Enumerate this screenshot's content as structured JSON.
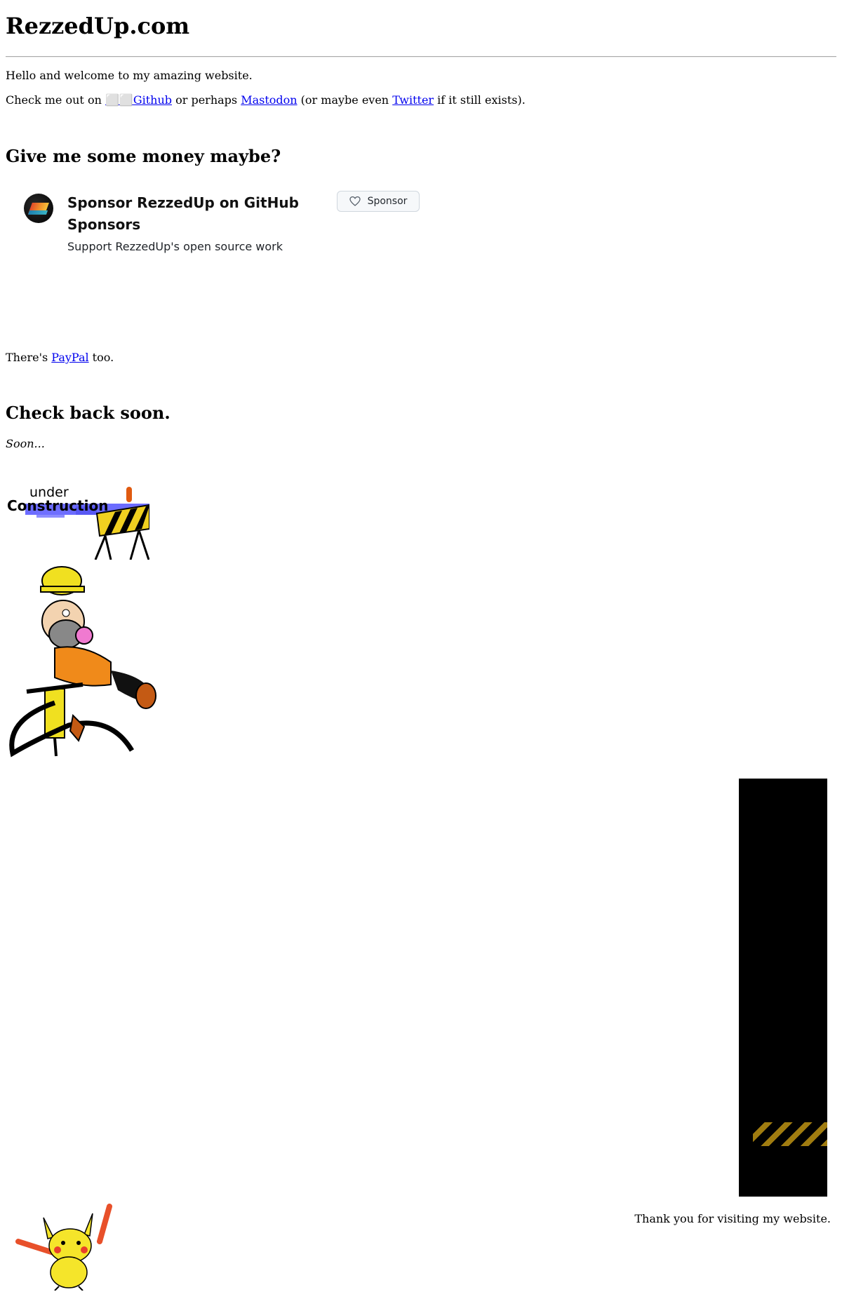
{
  "header": {
    "site_title": "RezzedUp.com"
  },
  "intro": {
    "welcome": "Hello and welcome to my amazing website.",
    "check_prefix": "Check me out on ",
    "github_link": "⬜⬜Github",
    "mid1": " or perhaps ",
    "mastodon_link": "Mastodon",
    "mid2": " (or maybe even ",
    "twitter_link": "Twitter",
    "suffix": " if it still exists)."
  },
  "money": {
    "heading": "Give me some money maybe?",
    "sponsor_title": "Sponsor RezzedUp on GitHub Sponsors",
    "sponsor_subtitle": "Support RezzedUp's open source work",
    "sponsor_button": "Sponsor",
    "paypal_prefix": "There's ",
    "paypal_link": "PayPal",
    "paypal_suffix": " too."
  },
  "soon": {
    "heading": "Check back soon.",
    "text": "Soon..."
  },
  "images": {
    "under_construction_under": "under",
    "under_construction_construction": "Construction"
  },
  "footer": {
    "thanks": "Thank you for visiting my website."
  },
  "colors": {
    "link": "#0000ee",
    "sign_yellow": "#f0d020",
    "worker_orange": "#f08a1a",
    "pikachu_yellow": "#f5e52a"
  }
}
